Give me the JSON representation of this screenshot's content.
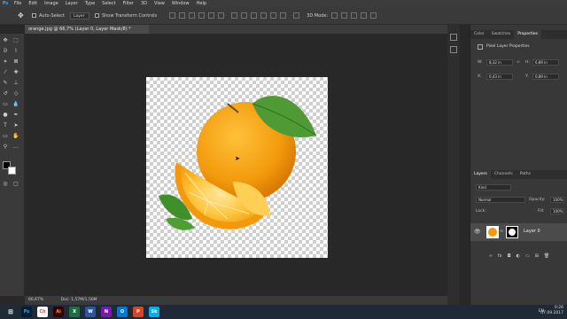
{
  "menu": [
    "File",
    "Edit",
    "Image",
    "Layer",
    "Type",
    "Select",
    "Filter",
    "3D",
    "View",
    "Window",
    "Help"
  ],
  "options": {
    "auto_select_label": "Auto-Select",
    "layer_select": "Layer",
    "transform_label": "Show Transform Controls"
  },
  "document_tab": "orange.jpg @ 66,7% (Layer 0, Layer Mask/8) *",
  "status": {
    "zoom": "66,67%",
    "doc_info": "Doc: 1,57M/1,56M"
  },
  "panels": {
    "top_tabs": [
      "Color",
      "Swatches",
      "Properties"
    ],
    "properties_title": "Pixel Layer Properties",
    "w_label": "W:",
    "w_value": "8,32 in",
    "h_label": "H:",
    "h_value": "6,89 in",
    "x_label": "X:",
    "x_value": "0,43 in",
    "y_label": "Y:",
    "y_value": "0,89 in",
    "go_label": "GO",
    "layer_tabs": [
      "Layers",
      "Channels",
      "Paths"
    ],
    "kind_label": "Kind",
    "blend_mode": "Normal",
    "opacity_label": "Opacity:",
    "opacity_value": "100%",
    "lock_label": "Lock:",
    "fill_label": "Fill:",
    "fill_value": "100%",
    "layer_name": "Layer 0"
  },
  "taskbar": {
    "apps": [
      {
        "name": "Ps",
        "color": "#001e36",
        "fg": "#31a8ff"
      },
      {
        "name": "Ch",
        "color": "#ffffff",
        "fg": "#dd4b39"
      },
      {
        "name": "Ai",
        "color": "#330000",
        "fg": "#ff9a00"
      },
      {
        "name": "X",
        "color": "#1d6f42",
        "fg": "#ffffff"
      },
      {
        "name": "W",
        "color": "#2b579a",
        "fg": "#ffffff"
      },
      {
        "name": "N",
        "color": "#7719aa",
        "fg": "#ffffff"
      },
      {
        "name": "O",
        "color": "#0078d4",
        "fg": "#ffffff"
      },
      {
        "name": "P",
        "color": "#d24726",
        "fg": "#ffffff"
      },
      {
        "name": "Sk",
        "color": "#00aff0",
        "fg": "#ffffff"
      }
    ],
    "lang": "EN",
    "time": "0:26",
    "date": "07.09.2017"
  }
}
